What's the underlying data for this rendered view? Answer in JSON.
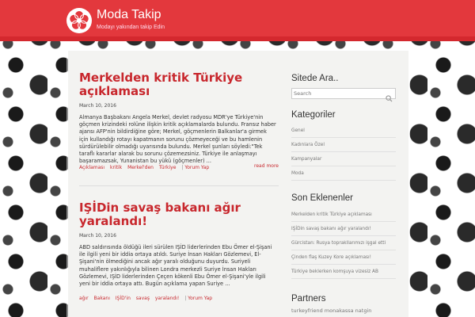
{
  "site": {
    "title": "Moda Takip",
    "description": "Modayı yakından takip Edin",
    "accent_color": "#e3383d",
    "logo_icon": "flower-logo-icon"
  },
  "posts": [
    {
      "title": "Merkelden kritik Türkiye açıklaması",
      "date": "March 10, 2016",
      "excerpt": "Almanya Başbakanı Angela Merkel, devlet radyosu MDR'ye Türkiye'nin göçmen krizindeki rolüne ilişkin kritik açıklamalarda bulundu. Fransız haber ajansı AFP'nin bildirdiğine göre; Merkel, göçmenlerin Balkanlar'a girmek için kullandığı rotayı kapatmanın sorunu çözmeyeceği ve bu hamlenin sürdürülebilir olmadığı uyarısında bulundu. Merkel şunları söyledi:\"Tek taraflı kararlar alarak bu sorunu çözemezsiniz. Türkiye ile anlaşmayı başaramazsak, Yunanistan bu yükü (göçmenler) ...",
      "tags": [
        "Açıklaması",
        "kritik",
        "Merkel'den",
        "Türkiye"
      ],
      "comment": "Yorum Yap",
      "read_more": "read more"
    },
    {
      "title": "IŞİDin savaş bakanı ağır yaralandı!",
      "date": "March 10, 2016",
      "excerpt": "ABD saldırısında öldüğü ileri sürülen IŞİD liderlerinden Ebu Ömer el-Şişani ile ilgili yeni bir iddia ortaya atıldı. Suriye İnsan Hakları Gözlemevi, El-Şişani'nin ölmediğini ancak ağır yaralı olduğunu duyurdu. Suriyeli muhaliflere yakınlığıyla bilinen Londra merkezli Suriye İnsan Hakları Gözlemevi, IŞİD liderlerinden Çeçen kökenli Ebu Ömer el-Şişani'yle ilgili yeni bir iddia ortaya attı. Bugün açıklama yapan Suriye ...",
      "tags": [
        "ağır",
        "Bakanı",
        "IŞİD'in",
        "savaş",
        "yaralandı!"
      ],
      "comment": "Yorum Yap"
    }
  ],
  "sidebar": {
    "search_title": "Sitede Ara..",
    "search_placeholder": "Search",
    "categories_title": "Kategoriler",
    "categories": [
      "Genel",
      "Kadınlara Özel",
      "Kampanyalar",
      "Moda"
    ],
    "recent_title": "Son Eklenenler",
    "recent": [
      "Merkelden kritik Türkiye açıklaması",
      "IŞİDin savaş bakanı ağır yaralandı!",
      "Gürcistan: Rusya toprakllarımızı işgal etti",
      "Çinden flaş Kuzey Kore açıklaması!",
      "Türkiye beklerken komşuya vizesiz AB"
    ],
    "partners_title": "Partners",
    "partners_text": "turkeyfriend monakassa natgin"
  }
}
